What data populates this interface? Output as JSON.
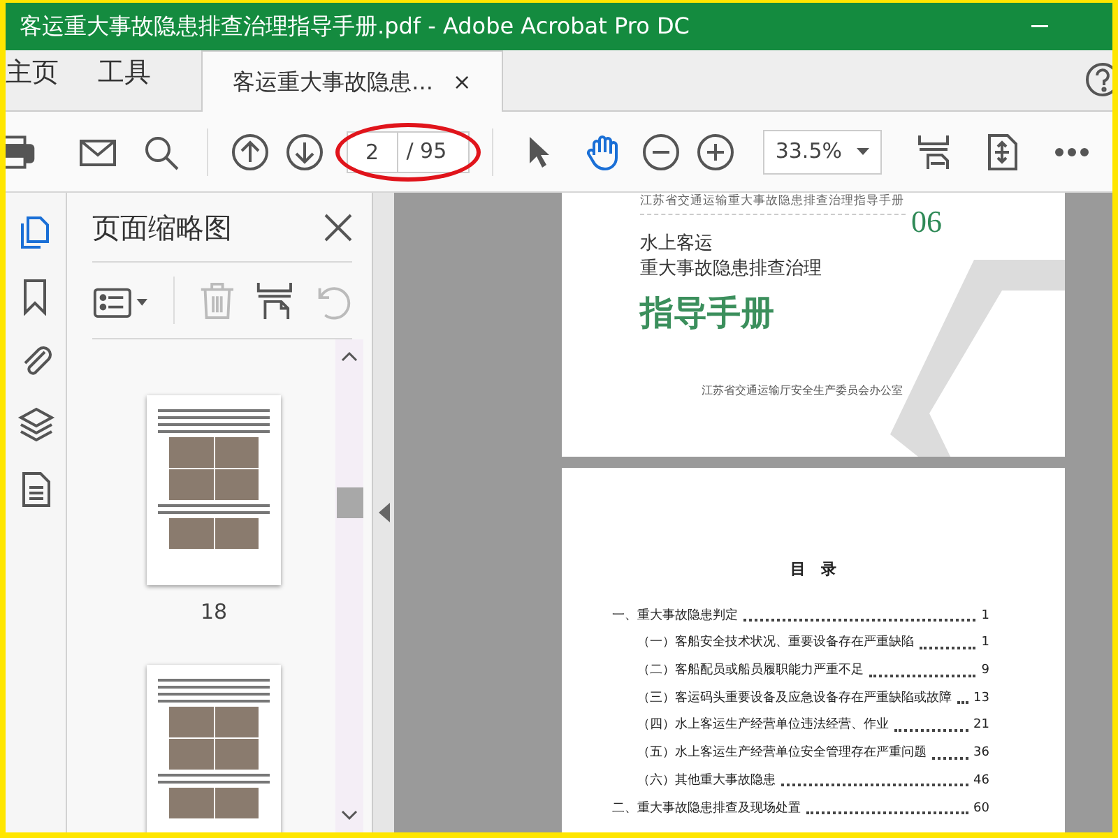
{
  "window": {
    "title": "客运重大事故隐患排查治理指导手册.pdf - Adobe Acrobat Pro DC"
  },
  "tabs": [
    {
      "label": "主页",
      "kind": "nav",
      "selected": false
    },
    {
      "label": "工具",
      "kind": "nav",
      "selected": false
    },
    {
      "label": "客运重大事故隐患...",
      "kind": "document",
      "selected": true,
      "close": "×"
    }
  ],
  "toolbar": {
    "tools": [
      {
        "kind": "select",
        "selected": false
      },
      {
        "kind": "hand",
        "selected": true
      }
    ],
    "page_field": {
      "value": "2",
      "total": "/ 95",
      "circled": true
    },
    "zoom": {
      "value": "33.5%"
    }
  },
  "left_rail": [
    {
      "kind": "pages",
      "selected": true
    },
    {
      "kind": "bookmarks",
      "selected": false
    },
    {
      "kind": "attachments",
      "selected": false
    },
    {
      "kind": "layers",
      "selected": false
    },
    {
      "kind": "content",
      "selected": false
    }
  ],
  "thumbnail_panel": {
    "title": "页面缩略图",
    "tools": [
      {
        "kind": "options",
        "disabled": false
      },
      {
        "kind": "delete",
        "disabled": true
      },
      {
        "kind": "insert",
        "disabled": false
      },
      {
        "kind": "rotate",
        "disabled": true
      }
    ],
    "thumbnails": [
      {
        "kind": "labeled",
        "label": "18"
      },
      {
        "kind": "cut_off"
      }
    ]
  },
  "document": {
    "cover": {
      "header": "江苏省交通运输重大事故隐患排查治理指导手册",
      "number": "06",
      "line_1": "水上客运",
      "line_2": "重大事故隐患排查治理",
      "title": "指导手册",
      "issuer": "江苏省交通运输厅安全生产委员会办公室"
    },
    "toc": {
      "title": "目　录",
      "entries": [
        {
          "text": "一、重大事故隐患判定",
          "page": "1",
          "children": [
            {
              "text": "（一）客船安全技术状况、重要设备存在严重缺陷",
              "page": "1"
            },
            {
              "text": "（二）客船配员或船员履职能力严重不足",
              "page": "9"
            },
            {
              "text": "（三）客运码头重要设备及应急设备存在严重缺陷或故障",
              "page": "13"
            },
            {
              "text": "（四）水上客运生产经营单位违法经营、作业",
              "page": "21"
            },
            {
              "text": "（五）水上客运生产经营单位安全管理存在严重问题",
              "page": "36"
            },
            {
              "text": "（六）其他重大事故隐患",
              "page": "46"
            }
          ]
        },
        {
          "text": "二、重大事故隐患排查及现场处置",
          "page": "60"
        }
      ]
    }
  }
}
